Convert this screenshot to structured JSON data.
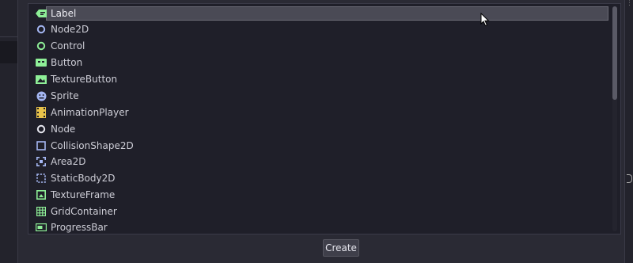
{
  "node_list": {
    "items": [
      {
        "label": "Label",
        "icon": "label-icon",
        "selected": true
      },
      {
        "label": "Node2D",
        "icon": "node2d-icon"
      },
      {
        "label": "Control",
        "icon": "control-icon"
      },
      {
        "label": "Button",
        "icon": "button-icon"
      },
      {
        "label": "TextureButton",
        "icon": "texture-button-icon"
      },
      {
        "label": "Sprite",
        "icon": "sprite-icon"
      },
      {
        "label": "AnimationPlayer",
        "icon": "animation-player-icon"
      },
      {
        "label": "Node",
        "icon": "node-icon"
      },
      {
        "label": "CollisionShape2D",
        "icon": "collision-shape-2d-icon"
      },
      {
        "label": "Area2D",
        "icon": "area2d-icon"
      },
      {
        "label": "StaticBody2D",
        "icon": "static-body-2d-icon"
      },
      {
        "label": "TextureFrame",
        "icon": "texture-frame-icon"
      },
      {
        "label": "GridContainer",
        "icon": "grid-container-icon"
      },
      {
        "label": "ProgressBar",
        "icon": "progress-bar-icon"
      }
    ]
  },
  "actions": {
    "create_label": "Create"
  },
  "colors": {
    "node_green": "#8eef97",
    "node_blue": "#a5b7f3",
    "anim_yellow": "#e8c24a",
    "selection_bg": "#4a4a55",
    "list_bg": "#1f1f29"
  }
}
